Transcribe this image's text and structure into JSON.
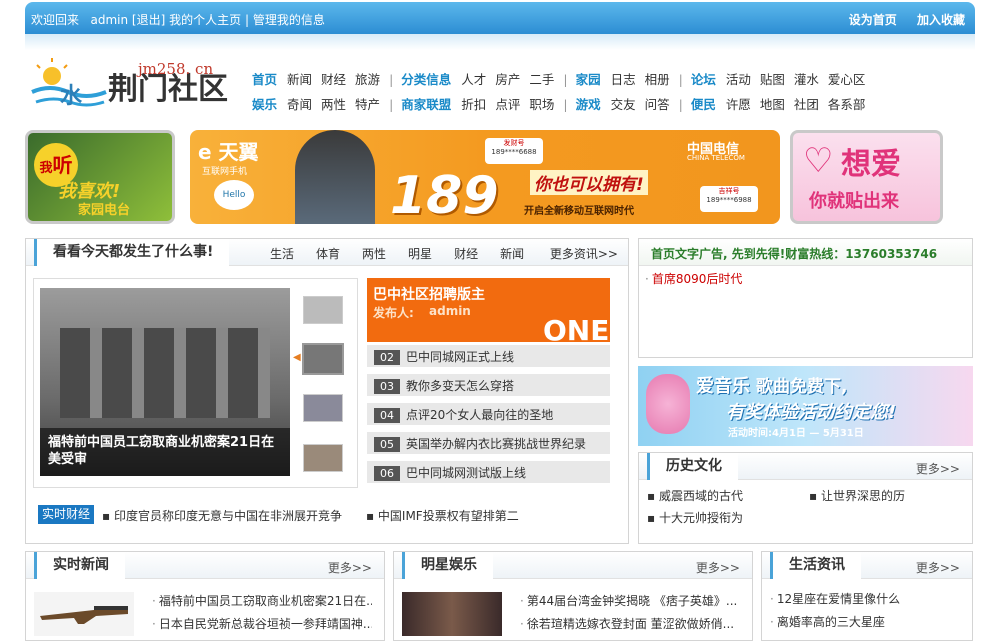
{
  "topbar": {
    "welcome": "欢迎回来",
    "user": "admin",
    "logout": "[退出]",
    "home": "我的个人主页",
    "sep": "|",
    "manage": "管理我的信息",
    "set_home": "设为首页",
    "favorite": "加入收藏"
  },
  "logo": {
    "domain": "jm258. cn",
    "name": "荆门社区"
  },
  "nav_row1": [
    {
      "label": "首页",
      "type": "h"
    },
    {
      "label": "新闻"
    },
    {
      "label": "财经"
    },
    {
      "label": "旅游"
    },
    {
      "label": "|",
      "type": "sep"
    },
    {
      "label": "分类信息",
      "type": "h"
    },
    {
      "label": "人才"
    },
    {
      "label": "房产"
    },
    {
      "label": "二手"
    },
    {
      "label": "|",
      "type": "sep"
    },
    {
      "label": "家园",
      "type": "h"
    },
    {
      "label": "日志"
    },
    {
      "label": "相册"
    },
    {
      "label": "|",
      "type": "sep"
    },
    {
      "label": "论坛",
      "type": "h"
    },
    {
      "label": "活动"
    },
    {
      "label": "贴图"
    },
    {
      "label": "灌水"
    },
    {
      "label": "爱心区"
    }
  ],
  "nav_row2": [
    {
      "label": "娱乐",
      "type": "h"
    },
    {
      "label": "奇闻"
    },
    {
      "label": "两性"
    },
    {
      "label": "特产"
    },
    {
      "label": "|",
      "type": "sep"
    },
    {
      "label": "商家联盟",
      "type": "h"
    },
    {
      "label": "折扣"
    },
    {
      "label": "点评"
    },
    {
      "label": "职场"
    },
    {
      "label": "|",
      "type": "sep"
    },
    {
      "label": "游戏",
      "type": "h"
    },
    {
      "label": "交友"
    },
    {
      "label": "问答"
    },
    {
      "label": "|",
      "type": "sep"
    },
    {
      "label": "便民",
      "type": "h"
    },
    {
      "label": "许愿"
    },
    {
      "label": "地图"
    },
    {
      "label": "社团"
    },
    {
      "label": "各系部"
    }
  ],
  "banners": {
    "radio": {
      "line1": "我",
      "line2": "听",
      "line3": "我喜欢!",
      "line4": "家园电台"
    },
    "tianyi": {
      "brand": "天翼",
      "sub": "互联网手机",
      "number": "189",
      "slogan": "你也可以拥有!",
      "tag": "开启全新移动互联网时代",
      "telecom": "中国电信",
      "telecom_en": "CHINA TELECOM",
      "hello": "Hello",
      "num_a_label": "发财号",
      "num_a": "189****6688",
      "num_b_label": "吉祥号",
      "num_b": "189****6988"
    },
    "love": {
      "line1": "想爱",
      "line2": "你就贴出来"
    },
    "music": {
      "title1": "爱音乐",
      "title2": "歌曲免费下,",
      "title3": "有奖体验活动约定您!",
      "date": "活动时间:4月1日 — 5月31日"
    }
  },
  "today": {
    "title": "看看今天都发生了什么事!",
    "tabs": [
      "生活",
      "体育",
      "两性",
      "明星",
      "财经",
      "新闻"
    ],
    "more": "更多资讯>>",
    "photo_caption": "福特前中国员工窃取商业机密案21日在美受审",
    "featured": {
      "title": "巴中社区招聘版主",
      "publisher_label": "发布人:",
      "publisher": "admin",
      "deco": "ONE"
    },
    "items": [
      {
        "n": "02",
        "text": "巴中同城网正式上线"
      },
      {
        "n": "03",
        "text": "教你多变天怎么穿搭"
      },
      {
        "n": "04",
        "text": "点评20个女人最向往的圣地"
      },
      {
        "n": "05",
        "text": "英国举办解内衣比赛挑战世界纪录"
      },
      {
        "n": "06",
        "text": "巴中同城网测试版上线"
      }
    ],
    "finance_label": "实时财经",
    "finance_items": [
      "印度官员称印度无意与中国在非洲展开竞争",
      "中国IMF投票权有望排第二"
    ]
  },
  "ad_panel": {
    "title": "首页文字广告, 先到先得!财富热线：13760353746",
    "items": [
      "首席8090后时代"
    ]
  },
  "history": {
    "title": "历史文化",
    "more": "更多>>",
    "items": [
      "威震西域的古代",
      "让世界深思的历",
      "十大元帅授衔为"
    ]
  },
  "news": {
    "title": "实时新闻",
    "more": "更多>>",
    "items": [
      "福特前中国员工窃取商业机密案21日在...",
      "日本自民党新总裁谷垣祯一参拜靖国神..."
    ]
  },
  "stars": {
    "title": "明星娱乐",
    "more": "更多>>",
    "items": [
      "第44届台湾金钟奖揭晓 《痞子英雄》...",
      "徐若瑄精选嫁衣登封面 董涩欲做娇俏..."
    ]
  },
  "life": {
    "title": "生活资讯",
    "more": "更多>>",
    "items": [
      "12星座在爱情里像什么",
      "离婚率高的三大星座"
    ]
  }
}
